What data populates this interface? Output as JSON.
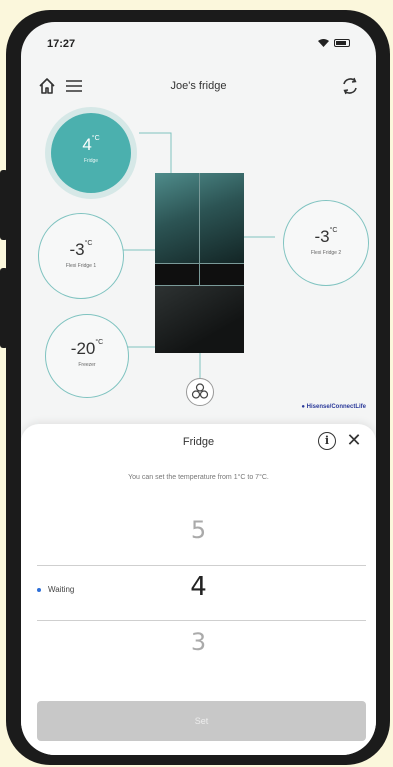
{
  "status_bar": {
    "time": "17:27"
  },
  "header": {
    "title": "Joe's fridge"
  },
  "compartments": [
    {
      "value": "4",
      "unit": "°C",
      "label": "Fridge"
    },
    {
      "value": "-3",
      "unit": "°C",
      "label": "Flexi Fridge 1"
    },
    {
      "value": "-3",
      "unit": "°C",
      "label": "Flexi Fridge 2"
    },
    {
      "value": "-20",
      "unit": "°C",
      "label": "Freezer"
    }
  ],
  "brand": "● Hisense/ConnectLife",
  "sheet": {
    "title": "Fridge",
    "hint": "You can set the temperature from 1°C to 7°C.",
    "picker": {
      "above": "5",
      "selected": "4",
      "below": "3"
    },
    "status": "Waiting",
    "set_label": "Set"
  },
  "colors": {
    "accent": "#4bb0ae",
    "status_dot": "#2e6fd8"
  }
}
